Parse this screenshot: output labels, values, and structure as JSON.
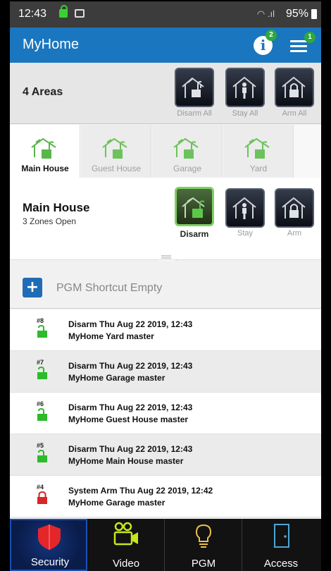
{
  "status_bar": {
    "time": "12:43",
    "battery": "95%"
  },
  "app_bar": {
    "title": "MyHome",
    "info_badge": "2",
    "menu_badge": "1"
  },
  "areas": {
    "label": "4 Areas",
    "actions": [
      {
        "label": "Disarm All",
        "icon": "house-unlocked-icon"
      },
      {
        "label": "Stay All",
        "icon": "house-person-icon"
      },
      {
        "label": "Arm All",
        "icon": "house-locked-icon"
      }
    ]
  },
  "area_tabs": [
    {
      "label": "Main House",
      "active": true
    },
    {
      "label": "Guest House",
      "active": false
    },
    {
      "label": "Garage",
      "active": false
    },
    {
      "label": "Yard",
      "active": false
    }
  ],
  "selected_area": {
    "name": "Main House",
    "status": "3 Zones Open",
    "actions": [
      {
        "label": "Disarm",
        "active": true
      },
      {
        "label": "Stay",
        "active": false
      },
      {
        "label": "Arm",
        "active": false
      }
    ]
  },
  "shortcut": {
    "text": "PGM Shortcut Empty"
  },
  "events": [
    {
      "num": "#8",
      "line1": "Disarm Thu Aug 22 2019, 12:43",
      "line2": "MyHome Yard master",
      "icon": "unlocked-green-icon"
    },
    {
      "num": "#7",
      "line1": "Disarm Thu Aug 22 2019, 12:43",
      "line2": "MyHome Garage master",
      "icon": "unlocked-green-icon"
    },
    {
      "num": "#6",
      "line1": "Disarm Thu Aug 22 2019, 12:43",
      "line2": "MyHome Guest House master",
      "icon": "unlocked-green-icon"
    },
    {
      "num": "#5",
      "line1": "Disarm Thu Aug 22 2019, 12:43",
      "line2": "MyHome Main House master",
      "icon": "unlocked-green-icon"
    },
    {
      "num": "#4",
      "line1": "System Arm Thu Aug 22 2019, 12:42",
      "line2": "MyHome Garage master",
      "icon": "locked-red-icon"
    }
  ],
  "bottom_nav": [
    {
      "label": "Security",
      "icon": "shield-icon",
      "active": true
    },
    {
      "label": "Video",
      "icon": "video-camera-icon",
      "active": false
    },
    {
      "label": "PGM",
      "icon": "bulb-icon",
      "active": false
    },
    {
      "label": "Access",
      "icon": "door-icon",
      "active": false
    }
  ],
  "colors": {
    "app_bar": "#1a76bf",
    "accent_green": "#2daa3a",
    "lock_red": "#d8252a",
    "nav_active": "#14357e"
  }
}
